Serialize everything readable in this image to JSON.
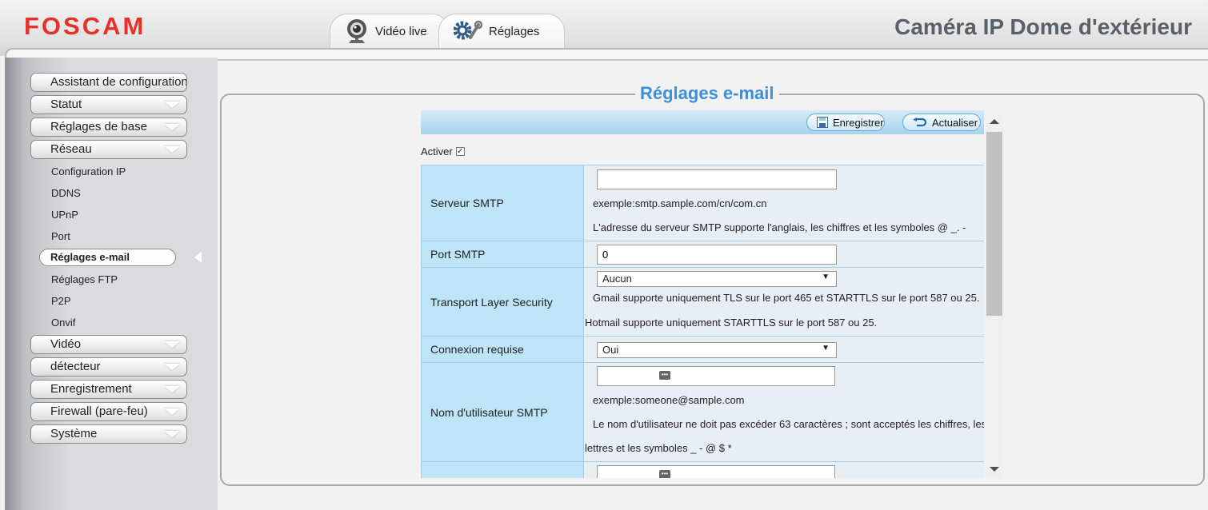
{
  "header": {
    "logo": "FOSCAM",
    "title": "Caméra IP Dome d'extérieur",
    "tabs": [
      {
        "label": "Vidéo live",
        "icon": "webcam-icon"
      },
      {
        "label": "Réglages",
        "icon": "gears-icon"
      }
    ]
  },
  "sidebar": {
    "menu": [
      {
        "label": "Assistant de configuration"
      },
      {
        "label": "Statut"
      },
      {
        "label": "Réglages de base"
      },
      {
        "label": "Réseau"
      },
      {
        "label": "Vidéo"
      },
      {
        "label": "détecteur"
      },
      {
        "label": "Enregistrement"
      },
      {
        "label": "Firewall (pare-feu)"
      },
      {
        "label": "Système"
      }
    ],
    "network_items": [
      "Configuration IP",
      "DDNS",
      "UPnP",
      "Port",
      "Réglages e-mail",
      "Réglages FTP",
      "P2P",
      "Onvif"
    ]
  },
  "main": {
    "section_title": "Réglages e-mail",
    "toolbar": {
      "save_label": "Enregistrer",
      "refresh_label": "Actualiser"
    },
    "enable_label": "Activer",
    "enable_checked": true,
    "fields": {
      "smtp_server": {
        "label": "Serveur SMTP",
        "value": "",
        "example": "exemple:smtp.sample.com/cn/com.cn",
        "note": "L'adresse du serveur SMTP supporte l'anglais, les chiffres et les symboles @ _. -"
      },
      "smtp_port": {
        "label": "Port SMTP",
        "value": "0"
      },
      "tls": {
        "label": "Transport Layer Security",
        "value": "Aucun",
        "note1": "Gmail supporte uniquement TLS sur le port 465 et STARTTLS sur le port 587 ou 25.",
        "note2": "Hotmail supporte uniquement STARTTLS sur le port 587 ou 25."
      },
      "auth": {
        "label": "Connexion requise",
        "value": "Oui"
      },
      "smtp_user": {
        "label": "Nom d'utilisateur SMTP",
        "value": "",
        "example": "exemple:someone@sample.com",
        "note1": "Le nom d'utilisateur ne doit pas excéder 63 caractères ; sont acceptés les chiffres, les",
        "note2": "lettres et les symboles _ - @ $ *"
      },
      "smtp_password": {
        "label": "",
        "value": ""
      }
    }
  }
}
